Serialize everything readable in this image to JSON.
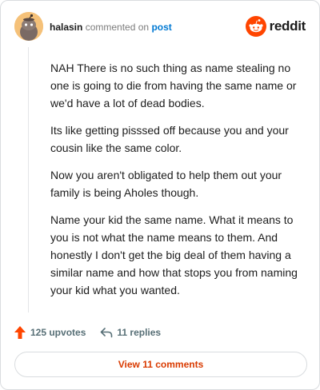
{
  "header": {
    "username": "halasin",
    "commented_on_text": "commented on",
    "post_link": "post",
    "brand_name": "reddit",
    "brand_icon": "reddit-snoo-icon",
    "avatar_icon": "snoo-avatar"
  },
  "comment": {
    "paragraphs": [
      "NAH There is no such thing as name stealing no one is going to die from having the same name or we'd have a lot of dead bodies.",
      "Its like getting pisssed off because you and your cousin like the same color.",
      "Now you aren't obligated to help them out your family is being Aholes though.",
      "Name your kid the same name. What it means to you is not what the name means to them. And honestly I don't get the big deal of them having a similar name and how that stops you from naming your kid what you wanted."
    ]
  },
  "actions": {
    "upvotes_label": "125 upvotes",
    "upvote_icon": "upvote-arrow-icon",
    "replies_label": "11 replies",
    "reply_icon": "reply-arrow-icon"
  },
  "footer": {
    "view_comments_label": "View 11 comments"
  },
  "colors": {
    "brand_orange": "#ff4500",
    "link_blue": "#0079d3",
    "button_text": "#d93a00",
    "action_gray": "#576f76"
  }
}
